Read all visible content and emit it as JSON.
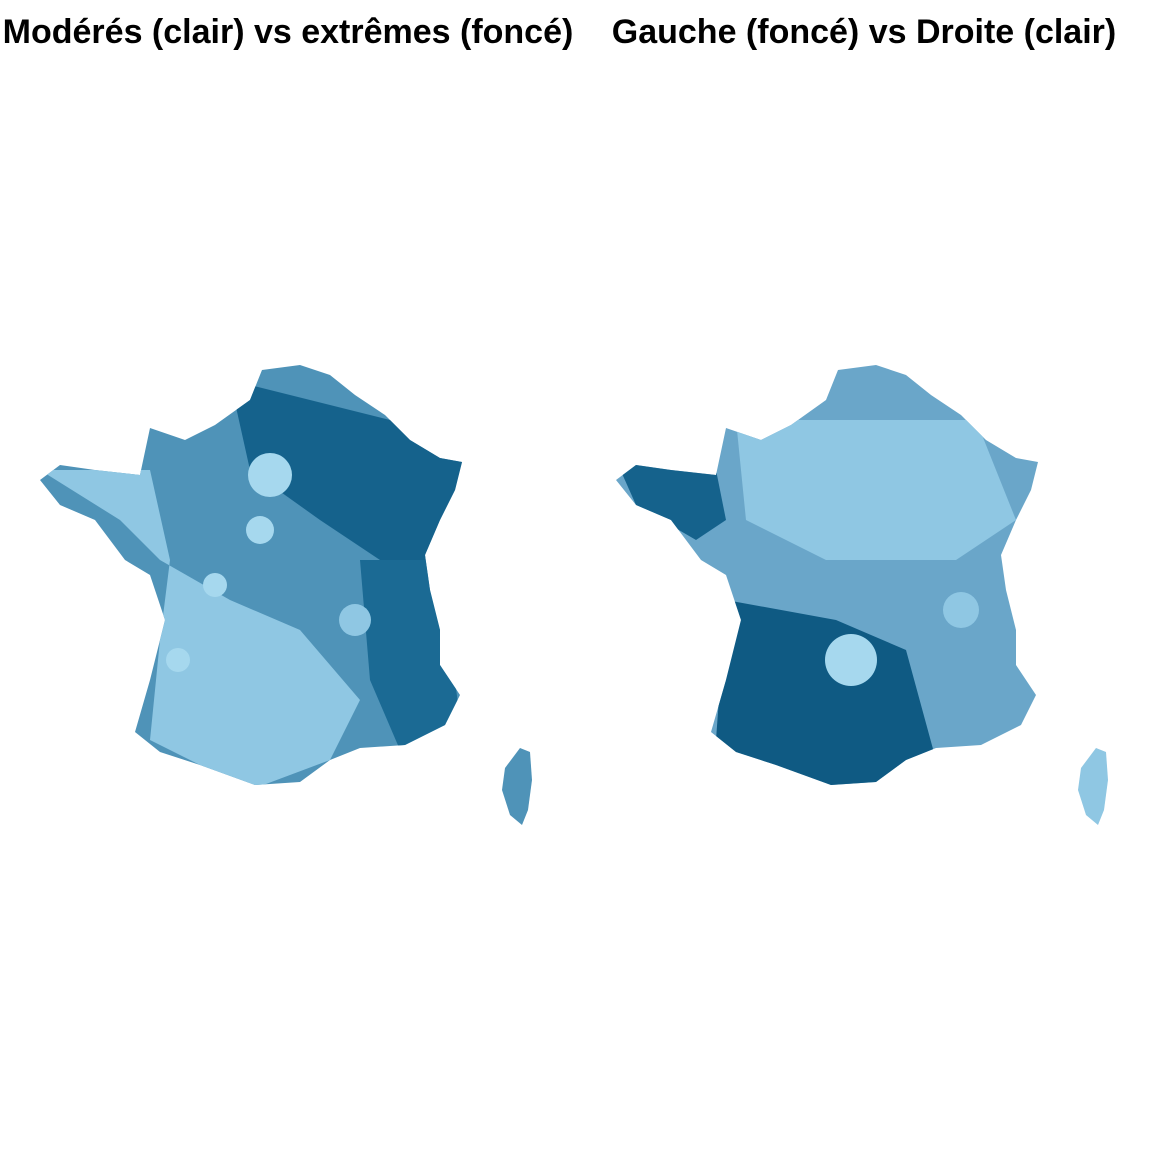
{
  "panels": [
    {
      "title": "Modérés (clair) vs extrêmes (foncé)",
      "colors": {
        "light": "#a6d8ee",
        "mid": "#4f93b8",
        "dark": "#0f5a83"
      }
    },
    {
      "title": "Gauche (foncé) vs Droite (clair)",
      "colors": {
        "light": "#a6d8ee",
        "mid": "#4f93b8",
        "dark": "#0f5a83"
      }
    }
  ]
}
